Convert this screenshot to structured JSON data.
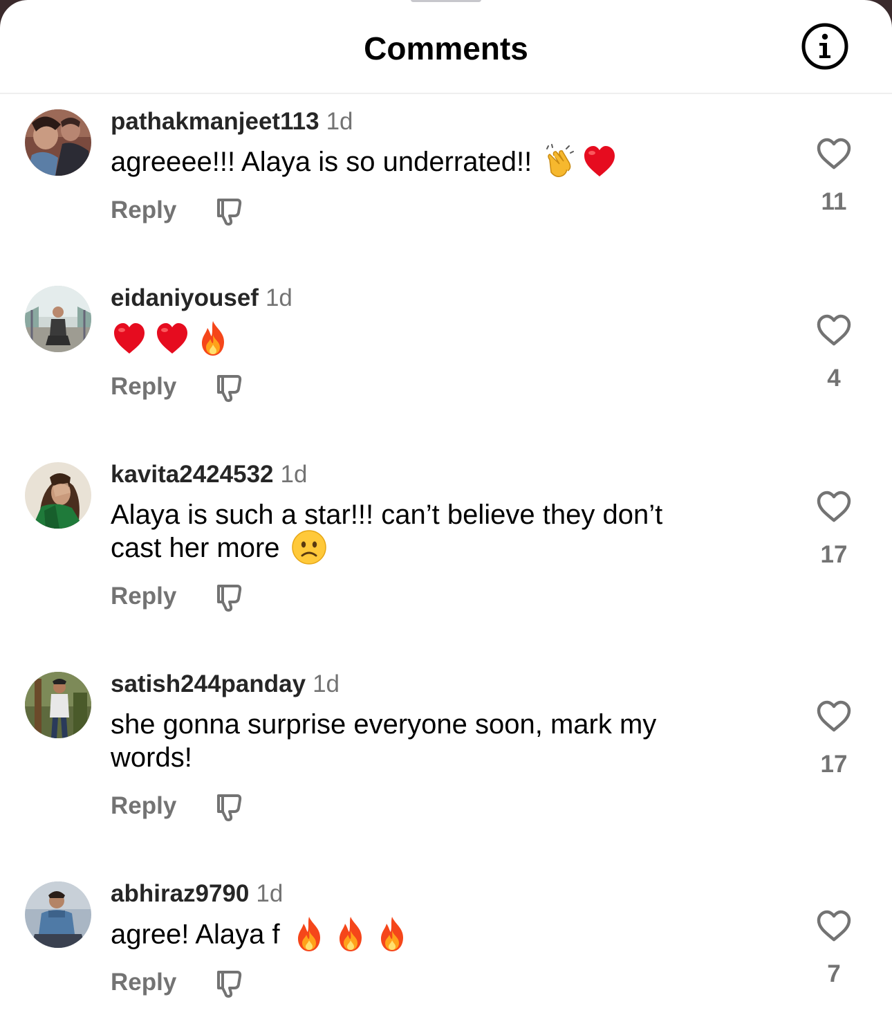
{
  "header": {
    "title": "Comments",
    "info_icon": "info-icon"
  },
  "colors": {
    "username": "#262626",
    "muted": "#737373",
    "text": "#000000",
    "divider": "#efefef"
  },
  "comments": [
    {
      "username": "pathakmanjeet113",
      "time": "1d",
      "text": [
        "agreeee!!! Alaya is so underrated!!"
      ],
      "emojis": [
        "clapping-hands-emoji",
        "red-heart-emoji"
      ],
      "reply_label": "Reply",
      "like_count": "11"
    },
    {
      "username": "eidaniyousef",
      "time": "1d",
      "text": [
        ""
      ],
      "emojis": [
        "red-heart-emoji",
        "red-heart-emoji",
        "fire-emoji"
      ],
      "reply_label": "Reply",
      "like_count": "4"
    },
    {
      "username": "kavita2424532",
      "time": "1d",
      "text": [
        "Alaya is such a star!!! can’t believe they don’t",
        "cast her more"
      ],
      "emojis": [
        "slightly-frowning-face-emoji"
      ],
      "reply_label": "Reply",
      "like_count": "17"
    },
    {
      "username": "satish244panday",
      "time": "1d",
      "text": [
        "she gonna surprise everyone soon, mark my",
        "words!"
      ],
      "emojis": [],
      "reply_label": "Reply",
      "like_count": "17"
    },
    {
      "username": "abhiraz9790",
      "time": "1d",
      "text": [
        "agree! Alaya f"
      ],
      "emojis": [
        "fire-emoji",
        "fire-emoji",
        "fire-emoji"
      ],
      "reply_label": "Reply",
      "like_count": "7"
    }
  ]
}
